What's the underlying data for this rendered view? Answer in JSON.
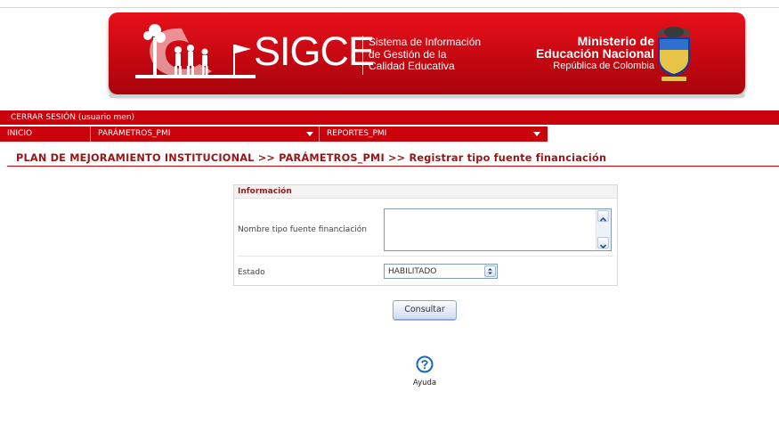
{
  "banner": {
    "logo_text": "SIGCE",
    "subtitle_lines": [
      "Sistema de Información",
      "de Gestión de la",
      "Calidad Educativa"
    ],
    "ministry_lines": [
      "Ministerio de",
      "Educación Nacional"
    ],
    "republic": "República de Colombia",
    "brand_color": "#c9020b"
  },
  "session": {
    "logout_label": "CERRAR SESIÓN (usuario men)"
  },
  "menu": {
    "items": [
      {
        "label": "INICIO",
        "has_dropdown": false
      },
      {
        "label": "PARÁMETROS_PMI",
        "has_dropdown": true
      },
      {
        "label": "REPORTES_PMI",
        "has_dropdown": true
      }
    ]
  },
  "breadcrumb": "PLAN DE MEJORAMIENTO INSTITUCIONAL >> PARÁMETROS_PMI >> Registrar tipo fuente financiación",
  "form": {
    "section_title": "Información",
    "name_label": "Nombre tipo fuente financiación",
    "name_value": "",
    "status_label": "Estado",
    "status_value": "HABILITADO"
  },
  "actions": {
    "consult_label": "Consultar"
  },
  "help": {
    "label": "Ayuda",
    "icon": "help-circle-icon"
  }
}
